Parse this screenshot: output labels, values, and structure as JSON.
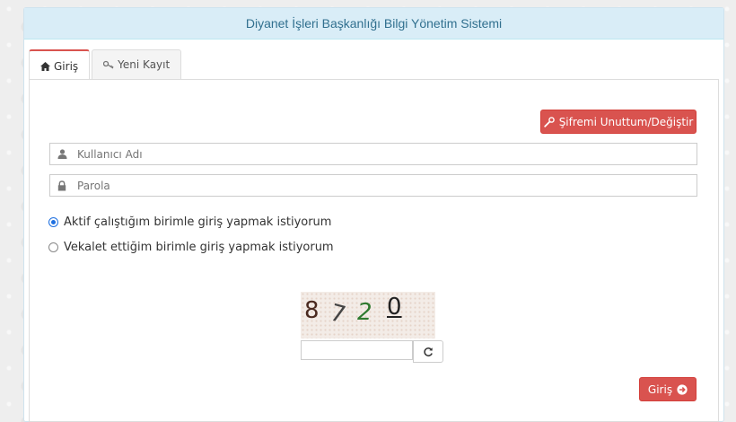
{
  "header": {
    "title": "Diyanet İşleri Başkanlığı Bilgi Yönetim Sistemi"
  },
  "tabs": [
    {
      "label": "Giriş",
      "icon": "home-icon",
      "active": true
    },
    {
      "label": "Yeni Kayıt",
      "icon": "key-icon",
      "active": false
    }
  ],
  "form": {
    "forgot_button": "Şifremi Unuttum/Değiştir",
    "username_placeholder": "Kullanıcı Adı",
    "password_placeholder": "Parola",
    "radio_options": [
      {
        "label": "Aktif çalıştığım birimle giriş yapmak istiyorum",
        "checked": true
      },
      {
        "label": "Vekalet ettiğim birimle giriş yapmak istiyorum",
        "checked": false
      }
    ],
    "captcha_chars": [
      "8",
      "7",
      "2",
      "0"
    ],
    "captcha_input_value": "",
    "submit_button": "Giriş"
  },
  "colors": {
    "header_bg": "#d9edf7",
    "header_text": "#31708f",
    "danger": "#d9534f",
    "radio_accent": "#1e6fe0"
  }
}
